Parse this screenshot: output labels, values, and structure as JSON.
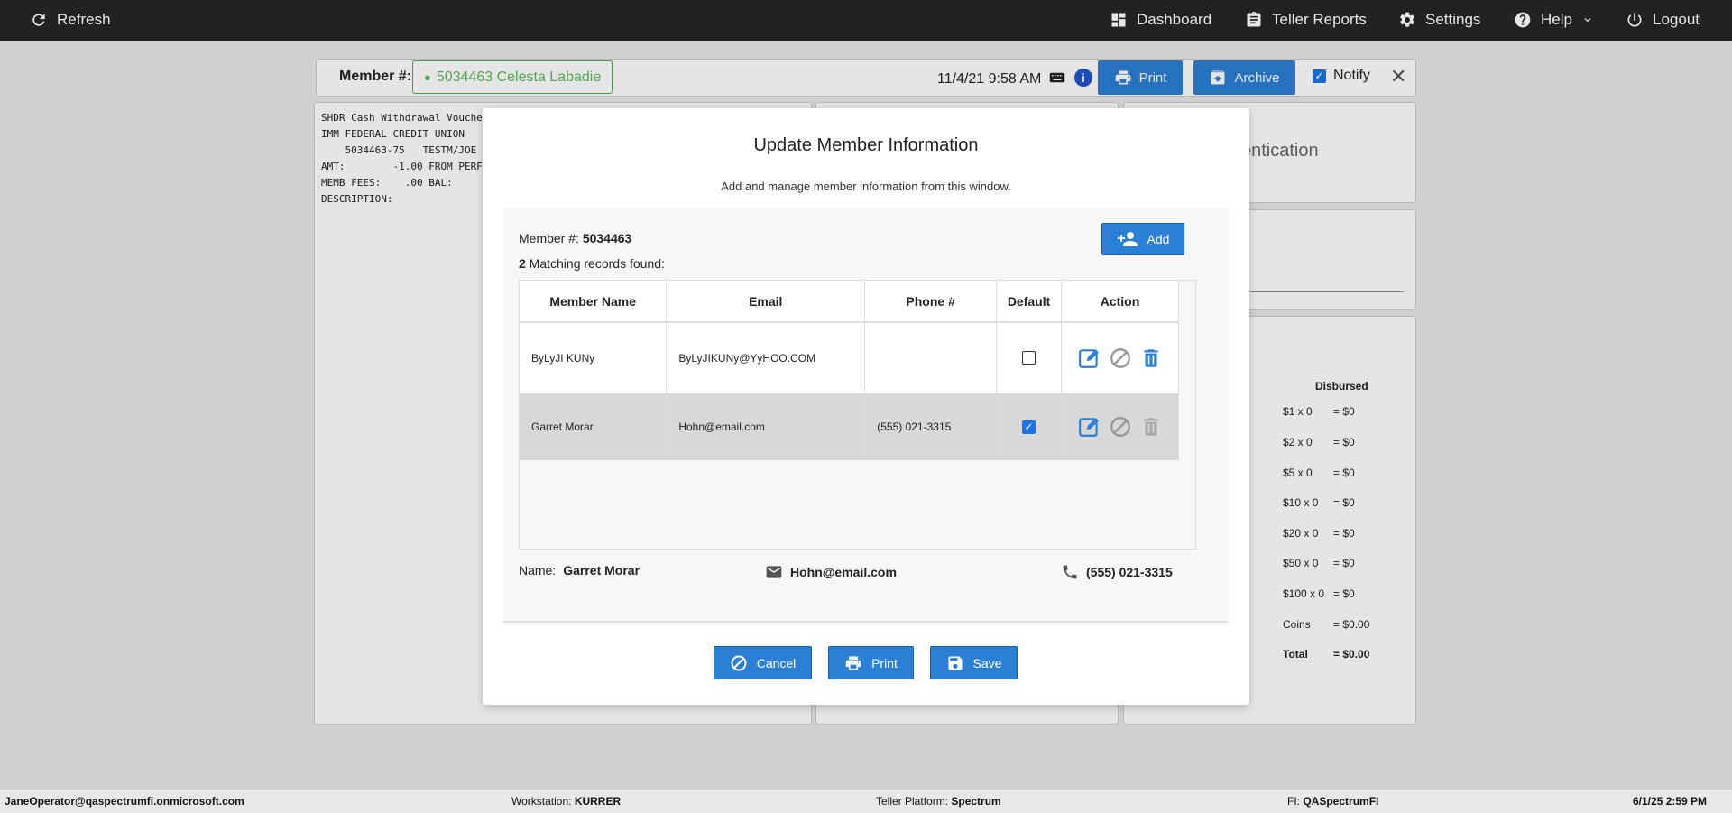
{
  "topbar": {
    "refresh": "Refresh",
    "dashboard": "Dashboard",
    "teller_reports": "Teller Reports",
    "settings": "Settings",
    "help": "Help",
    "logout": "Logout"
  },
  "memberbar": {
    "label": "Member #:",
    "member": "5034463 Celesta Labadie",
    "datetime": "11/4/21 9:58 AM",
    "info": "i",
    "print": "Print",
    "archive": "Archive",
    "notify": "Notify"
  },
  "receipt": "SHDR Cash Withdrawal Vouche\nIMM FEDERAL CREDIT UNION\n    5034463-75   TESTM/JOE\nAMT:        -1.00 FROM PERF\nMEMB FEES:    .00 BAL:\nDESCRIPTION:",
  "right_panel": {
    "auth_text": "entication",
    "disbursed_title": "Disbursed",
    "denoms": [
      {
        "label": "$1 x 0",
        "value": "= $0"
      },
      {
        "label": "$2 x 0",
        "value": "= $0"
      },
      {
        "label": "$5 x 0",
        "value": "= $0"
      },
      {
        "label": "$10 x 0",
        "value": "= $0"
      },
      {
        "label": "$20 x 0",
        "value": "= $0"
      },
      {
        "label": "$50 x 0",
        "value": "= $0"
      },
      {
        "label": "$100 x 0",
        "value": "= $0"
      },
      {
        "label": "Coins",
        "value": "= $0.00"
      },
      {
        "label": "Total",
        "value": "= $0.00"
      }
    ]
  },
  "modal": {
    "title": "Update Member Information",
    "subtitle": "Add and manage member information from this window.",
    "member_label": "Member #:",
    "member_number": "5034463",
    "match_count": "2",
    "match_text": " Matching records found:",
    "add_label": "Add",
    "columns": [
      "Member Name",
      "Email",
      "Phone #",
      "Default",
      "Action"
    ],
    "rows": [
      {
        "name": "ByLyJI KUNy",
        "email": "ByLyJIKUNy@YyHOO.COM",
        "phone": "",
        "default": false
      },
      {
        "name": "Garret Morar",
        "email": "Hohn@email.com",
        "phone": "(555) 021-3315",
        "default": true
      }
    ],
    "summary": {
      "name_label": "Name:",
      "name": "Garret Morar",
      "email": "Hohn@email.com",
      "phone": "(555) 021-3315"
    },
    "buttons": {
      "cancel": "Cancel",
      "print": "Print",
      "save": "Save"
    }
  },
  "footer": {
    "user": "JaneOperator@qaspectrumfi.onmicrosoft.com",
    "workstation_label": "Workstation:",
    "workstation": "KURRER",
    "platform_label": "Teller Platform:",
    "platform": "Spectrum",
    "fi_label": "FI:",
    "fi": "QASpectrumFI",
    "datetime": "6/1/25 2:59 PM"
  },
  "colors": {
    "accent": "#2b7fd4",
    "topbar": "#222222",
    "member_green": "#5cb85c"
  }
}
